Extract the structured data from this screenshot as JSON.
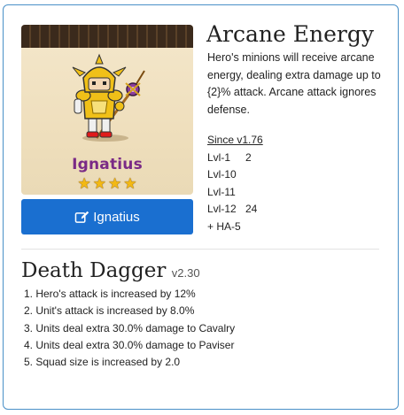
{
  "hero": {
    "portrait_name": "Ignatius",
    "stars": 4,
    "button_label": "Ignatius",
    "icon": "edit-icon"
  },
  "skill": {
    "title": "Arcane Energy",
    "description": "Hero's minions will receive arcane energy, dealing extra damage up to {2}% attack. Arcane attack ignores defense.",
    "since": "Since v1.76",
    "levels": [
      {
        "label": "Lvl-1",
        "value": "2"
      },
      {
        "label": "Lvl-10",
        "value": ""
      },
      {
        "label": "Lvl-11",
        "value": ""
      },
      {
        "label": "Lvl-12",
        "value": "24"
      }
    ],
    "extra": "+ HA-5"
  },
  "talent": {
    "name": "Death Dagger",
    "version": "v2.30",
    "effects": [
      "1. Hero's attack is increased by 12%",
      "2. Unit's attack is increased by 8.0%",
      "3. Units deal extra 30.0% damage to Cavalry",
      "4. Units deal extra 30.0% damage to Paviser",
      "5. Squad size is increased by 2.0"
    ]
  },
  "colors": {
    "button": "#1a6fd0",
    "border": "#4a90c8",
    "portrait_name": "#7a2a86",
    "star": "#f3b914"
  }
}
